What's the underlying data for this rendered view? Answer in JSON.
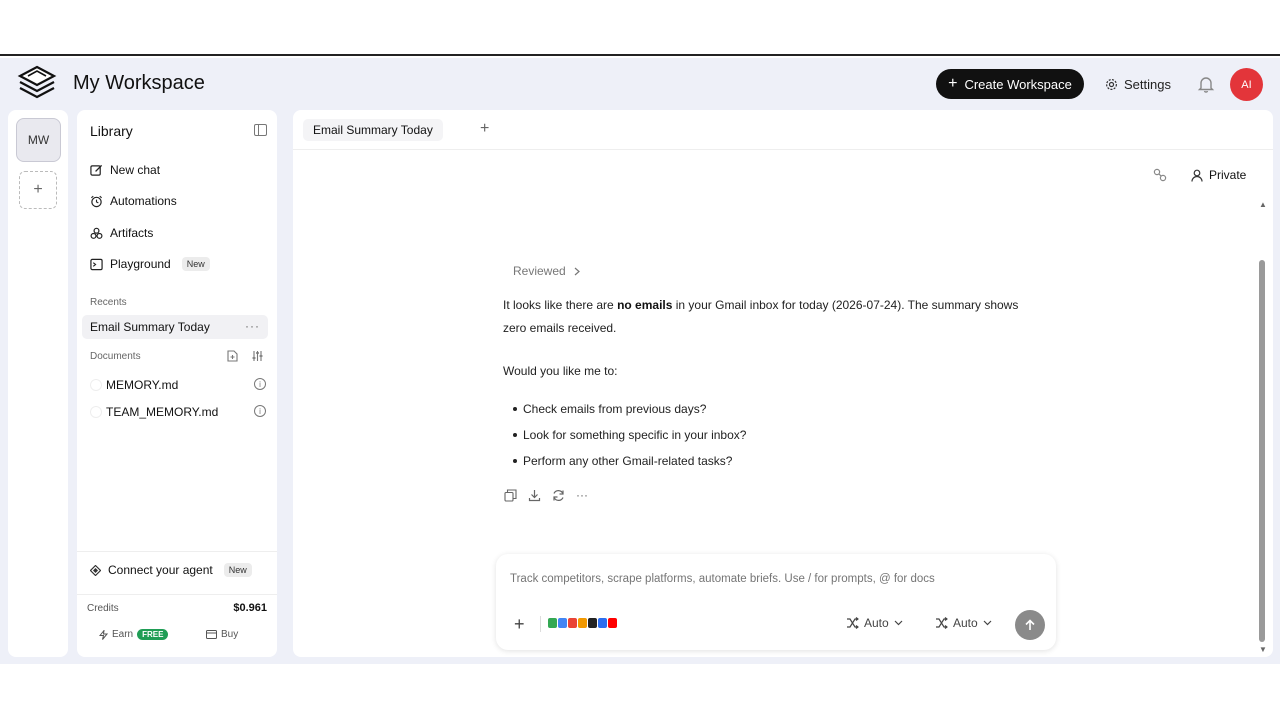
{
  "header": {
    "workspace_title": "My Workspace",
    "create_label": "Create Workspace",
    "settings_label": "Settings",
    "avatar_initials": "AI",
    "avatar_color": "#e3353a"
  },
  "rail": {
    "workspace_badge": "MW",
    "add_label": "+"
  },
  "library": {
    "title": "Library",
    "nav": [
      {
        "label": "New chat",
        "icon": "edit-icon"
      },
      {
        "label": "Automations",
        "icon": "alarm-icon"
      },
      {
        "label": "Artifacts",
        "icon": "artifacts-icon"
      },
      {
        "label": "Playground",
        "icon": "terminal-icon",
        "badge": "New"
      }
    ],
    "recents_label": "Recents",
    "recents": [
      {
        "label": "Email Summary Today",
        "more": "···"
      }
    ],
    "documents_label": "Documents",
    "documents": [
      {
        "label": "MEMORY.md"
      },
      {
        "label": "TEAM_MEMORY.md"
      }
    ],
    "connect_label": "Connect your agent",
    "connect_badge": "New",
    "credits_label": "Credits",
    "credits_value": "$0.961",
    "earn_label": "Earn",
    "earn_badge": "FREE",
    "buy_label": "Buy"
  },
  "main": {
    "tab_label": "Email Summary Today",
    "tab_add": "+",
    "private_label": "Private",
    "reviewed_label": "Reviewed",
    "message": {
      "line1_pre": "It looks like there are ",
      "line1_bold": "no emails",
      "line1_post": " in your Gmail inbox for today (2026-07-24). The summary shows zero emails received.",
      "question": "Would you like me to:",
      "bullets": [
        "Check emails from previous days?",
        "Look for something specific in your inbox?",
        "Perform any other Gmail-related tasks?"
      ]
    },
    "composer": {
      "placeholder": "Track competitors, scrape platforms, automate briefs. Use / for prompts, @ for docs",
      "mode1": "Auto",
      "mode2": "Auto",
      "add_label": "+"
    }
  },
  "colors": {
    "accent": "#111111",
    "app_bg": "#eef0f8",
    "free_badge": "#1f9d55"
  }
}
